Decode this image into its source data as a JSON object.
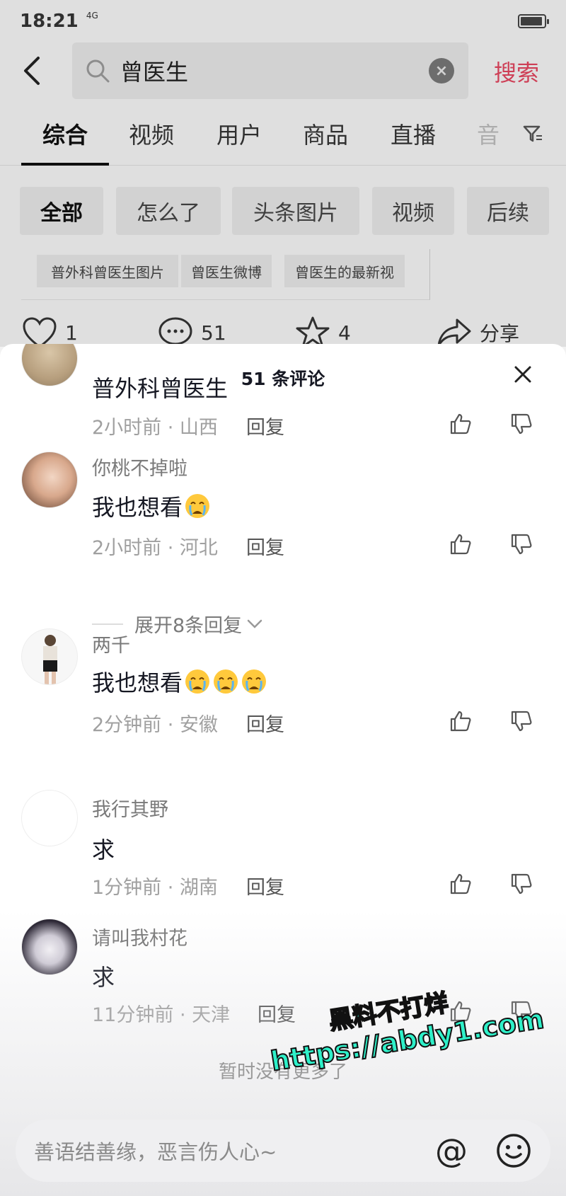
{
  "status_bar": {
    "time": "18:21",
    "signal": "4G"
  },
  "search": {
    "query": "曾医生",
    "button_label": "搜索"
  },
  "tabs": [
    {
      "label": "综合",
      "active": true
    },
    {
      "label": "视频"
    },
    {
      "label": "用户"
    },
    {
      "label": "商品"
    },
    {
      "label": "直播"
    },
    {
      "label": "音"
    }
  ],
  "chips": [
    {
      "label": "全部",
      "active": true
    },
    {
      "label": "怎么了"
    },
    {
      "label": "头条图片"
    },
    {
      "label": "视频"
    },
    {
      "label": "后续"
    }
  ],
  "related_searches": [
    "普外科曾医生图片",
    "曾医生微博",
    "曾医生的最新视"
  ],
  "post_actions": {
    "likes": "1",
    "comments": "51",
    "favorites": "4",
    "share_label": "分享"
  },
  "comments_sheet": {
    "title": "51 条评论",
    "comments": [
      {
        "user": "",
        "text": "普外科曾医生",
        "meta": "2小时前 · 山西",
        "reply_label": "回复",
        "emojis": 0
      },
      {
        "user": "你桃不掉啦",
        "text": "我也想看",
        "meta": "2小时前 · 河北",
        "reply_label": "回复",
        "emojis": 1
      },
      {
        "user": "两千",
        "text": "我也想看",
        "meta": "2分钟前 · 安徽",
        "reply_label": "回复",
        "emojis": 3
      },
      {
        "user": "我行其野",
        "text": "求",
        "meta": "1分钟前 · 湖南",
        "reply_label": "回复",
        "emojis": 0
      },
      {
        "user": "请叫我村花",
        "text": "求",
        "meta": "11分钟前 · 天津",
        "reply_label": "回复",
        "emojis": 0
      }
    ],
    "expand_label": "展开8条回复",
    "no_more": "暂时没有更多了",
    "input_placeholder": "善语结善缘，恶言伤人心~",
    "at_symbol": "@"
  },
  "watermark": {
    "line1": "黑料不打烊",
    "line2": "https://abdy1.com"
  },
  "colors": {
    "accent": "#e0455e",
    "watermark": "#2ef0c9"
  }
}
